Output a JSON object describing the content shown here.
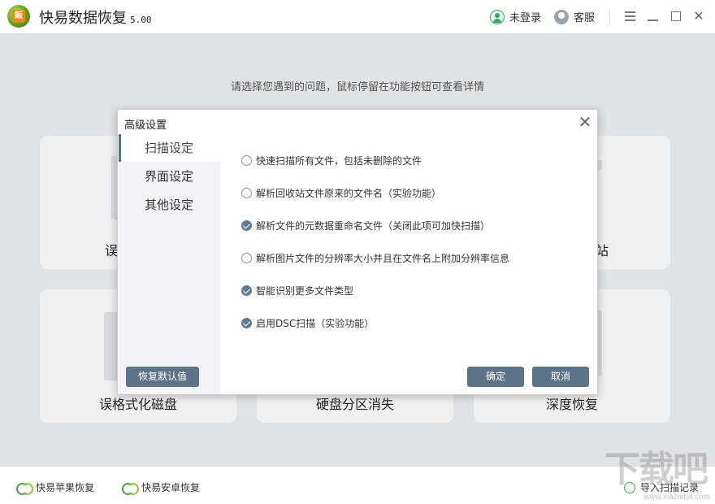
{
  "app": {
    "logo_text": "販",
    "title": "快易数据恢复",
    "version": "5.00",
    "user_label": "未登录",
    "service_label": "客服"
  },
  "main": {
    "hint": "请选择您遇到的问题，鼠标停留在功能按钮可查看详情",
    "cards": [
      {
        "label": "误删除文件"
      },
      {
        "label": "误清空回收站"
      },
      {
        "label": "误格式化磁盘"
      },
      {
        "label": "硬盘分区消失"
      },
      {
        "label": "深度恢复"
      }
    ],
    "card_visible_fragments": {
      "left_top": "误",
      "right_top": "站"
    }
  },
  "footer": {
    "apple": "快易苹果恢复",
    "android": "快易安卓恢复",
    "import": "导入扫描记录",
    "watermark": "下载吧",
    "watermark_url": "www.xiazaiba.com"
  },
  "dialog": {
    "title": "高级设置",
    "tabs": [
      {
        "label": "扫描设定",
        "active": true
      },
      {
        "label": "界面设定",
        "active": false
      },
      {
        "label": "其他设定",
        "active": false
      }
    ],
    "options": [
      {
        "label": "快速扫描所有文件，包括未删除的文件",
        "checked": false
      },
      {
        "label": "解析回收站文件原来的文件名（实验功能）",
        "checked": false
      },
      {
        "label": "解析文件的元数据重命名文件（关闭此项可加快扫描）",
        "checked": true
      },
      {
        "label": "解析图片文件的分辨率大小并且在文件名上附加分辨率信息",
        "checked": false
      },
      {
        "label": "智能识别更多文件类型",
        "checked": true
      },
      {
        "label": "启用DSC扫描（实验功能）",
        "checked": true
      }
    ],
    "restore_default": "恢复默认值",
    "ok": "确定",
    "cancel": "取消"
  },
  "colors": {
    "accent": "#5e7388",
    "brand_green": "#3ea64a",
    "background": "#eef1f5"
  }
}
